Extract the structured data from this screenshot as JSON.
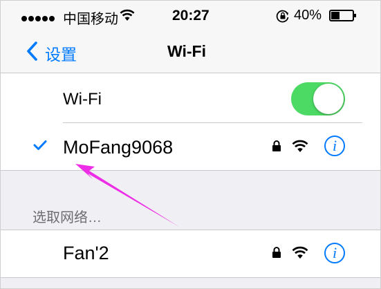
{
  "colors": {
    "accent": "#007aff",
    "toggle_on": "#4cd964",
    "group_bg": "#efeff4",
    "bar_bg": "#f7f7f7",
    "separator": "#c8c7cc",
    "section_label": "#6d6d72",
    "annotation_arrow": "#ee2ee6"
  },
  "status_bar": {
    "signal_dots": 5,
    "carrier": "中国移动",
    "wifi_icon": "wifi-icon",
    "time": "20:27",
    "orientation_lock_icon": "orientation-lock-icon",
    "battery_percent": "40%",
    "battery_level": 0.4
  },
  "nav_bar": {
    "back_label": "设置",
    "back_icon": "chevron-left-icon",
    "title": "Wi-Fi"
  },
  "wifi_toggle": {
    "label": "Wi-Fi",
    "on": true
  },
  "connected_network": {
    "checkmark_icon": "checkmark-icon",
    "name": "MoFang9068",
    "lock_icon": "lock-icon",
    "signal_icon": "wifi-signal-icon",
    "info_icon": "info-icon",
    "info_glyph": "i"
  },
  "choose_network_section": {
    "header": "选取网络…",
    "networks": [
      {
        "name": "Fan'2",
        "lock_icon": "lock-icon",
        "signal_icon": "wifi-signal-icon",
        "info_icon": "info-icon",
        "info_glyph": "i"
      }
    ]
  },
  "annotation": {
    "arrow_icon": "annotation-arrow-icon"
  }
}
